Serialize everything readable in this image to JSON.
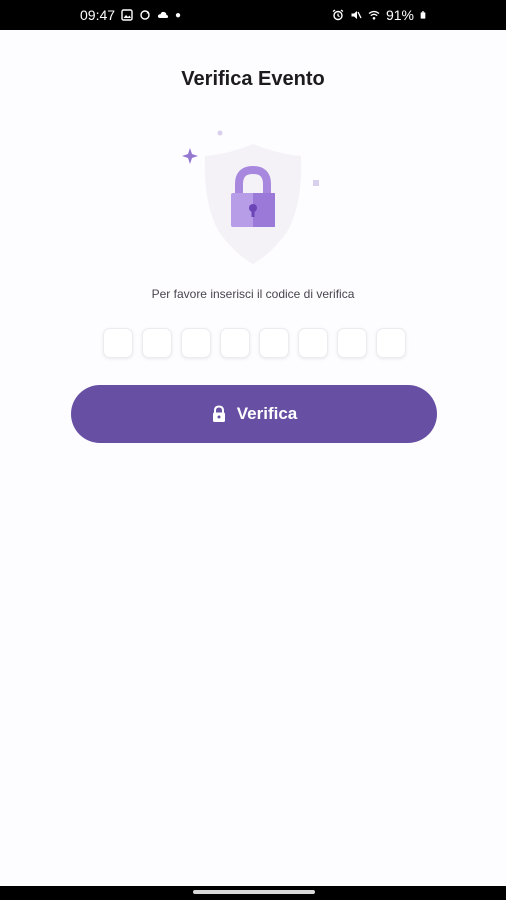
{
  "status_bar": {
    "time": "09:47",
    "battery": "91%",
    "left_icons": [
      "gallery-icon",
      "sync-icon",
      "cloud-icon",
      "dot-icon"
    ],
    "right_icons": [
      "alarm-icon",
      "mute-icon",
      "wifi-icon",
      "battery-icon"
    ]
  },
  "page": {
    "title": "Verifica Evento",
    "prompt": "Per favore inserisci il codice di verifica",
    "code_length": 8
  },
  "verify_button": {
    "label": "Verifica",
    "icon": "lock-icon"
  },
  "colors": {
    "primary": "#6750a4",
    "lock_light": "#b79ce8",
    "lock_dark": "#8a63d2",
    "background": "#fdfcfe"
  }
}
